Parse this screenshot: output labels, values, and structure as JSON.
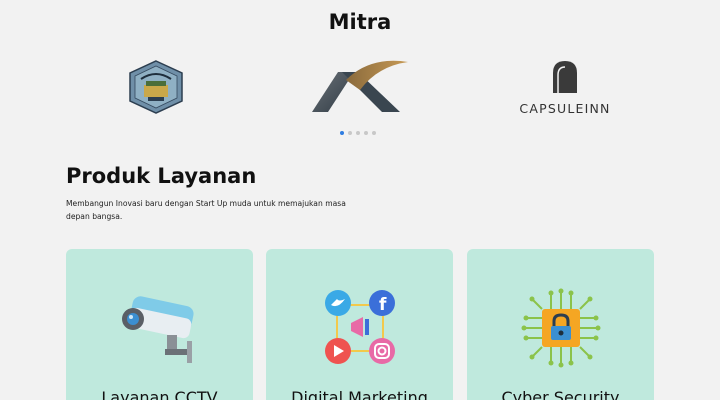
{
  "mitra": {
    "title": "Mitra",
    "partners": [
      {
        "name": "Universitas Lampung"
      },
      {
        "name": "X logo"
      },
      {
        "name": "CAPSULEINN"
      }
    ],
    "carousel": {
      "total": 5,
      "active": 0
    }
  },
  "produk": {
    "title": "Produk Layanan",
    "description": "Membangun Inovasi baru dengan Start Up muda untuk memajukan masa depan bangsa.",
    "cards": [
      {
        "title": "Layanan CCTV",
        "icon": "cctv-camera-icon"
      },
      {
        "title": "Digital Marketing",
        "icon": "social-media-icon"
      },
      {
        "title": "Cyber Security",
        "icon": "circuit-lock-icon"
      }
    ]
  },
  "colors": {
    "background": "#f2f2f2",
    "card": "#bfe9dd",
    "dot_active": "#2f7de1",
    "dot_inactive": "#c8c8c8"
  }
}
